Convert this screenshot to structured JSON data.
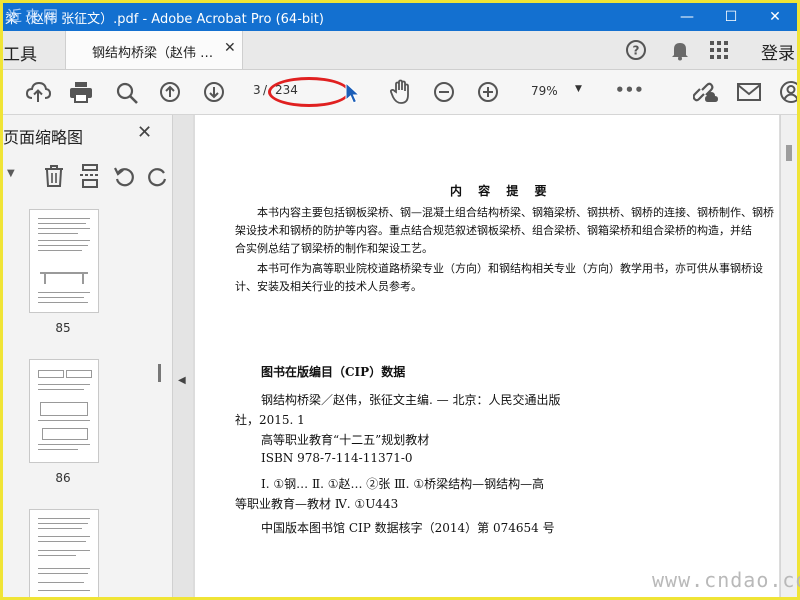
{
  "window": {
    "title": "梁（赵伟 张征文）.pdf - Adobe Acrobat Pro (64-bit)",
    "minimize": "—",
    "maximize": "☐",
    "close": "✕"
  },
  "watermark_top": "近来网",
  "watermark_bottom": "www.cndao.com",
  "tabs": {
    "tools": "工具",
    "document": "钢结构桥梁（赵伟 …",
    "close": "✕"
  },
  "header": {
    "login": "登录",
    "help_icon": "question-circle-icon",
    "bell_icon": "bell-icon",
    "apps_icon": "apps-grid-icon"
  },
  "toolbar": {
    "page_current": "3",
    "page_separator": "/",
    "page_total": "234",
    "zoom": "79%",
    "more": "•••"
  },
  "sidepanel": {
    "title": "页面缩略图",
    "close": "✕",
    "thumbnails": [
      {
        "label": "85"
      },
      {
        "label": "86"
      },
      {
        "label": ""
      }
    ]
  },
  "document": {
    "summary_title": "内 容 提 要",
    "summary_p1_lines": [
      "本书内容主要包括钢板梁桥、钢—混凝土组合结构桥梁、钢箱梁桥、钢拱桥、钢桥的连接、钢桥制作、钢桥",
      "架设技术和钢桥的防护等内容。重点结合规范叙述钢板梁桥、组合梁桥、钢箱梁桥和组合梁桥的构造，并结",
      "合实例总结了钢梁桥的制作和架设工艺。"
    ],
    "summary_p2_lines": [
      "本书可作为高等职业院校道路桥梁专业（方向）和钢结构相关专业（方向）教学用书，亦可供从事钢桥设",
      "计、安装及相关行业的技术人员参考。"
    ],
    "cip_title": "图书在版编目（CIP）数据",
    "cip_line1": "钢结构桥梁／赵伟，张征文主编. — 北京：人民交通出版",
    "cip_line2": "社，2015. 1",
    "cip_line3": "高等职业教育“十二五”规划教材",
    "cip_line4": "ISBN  978-7-114-11371-0",
    "cip_line5": "Ⅰ. ①钢…  Ⅱ. ①赵…   ②张  Ⅲ. ①桥梁结构—钢结构—高",
    "cip_line6": "等职业教育—教材  Ⅳ. ①U443",
    "cip_line7": "中国版本图书馆 CIP 数据核字（2014）第 074654 号"
  }
}
